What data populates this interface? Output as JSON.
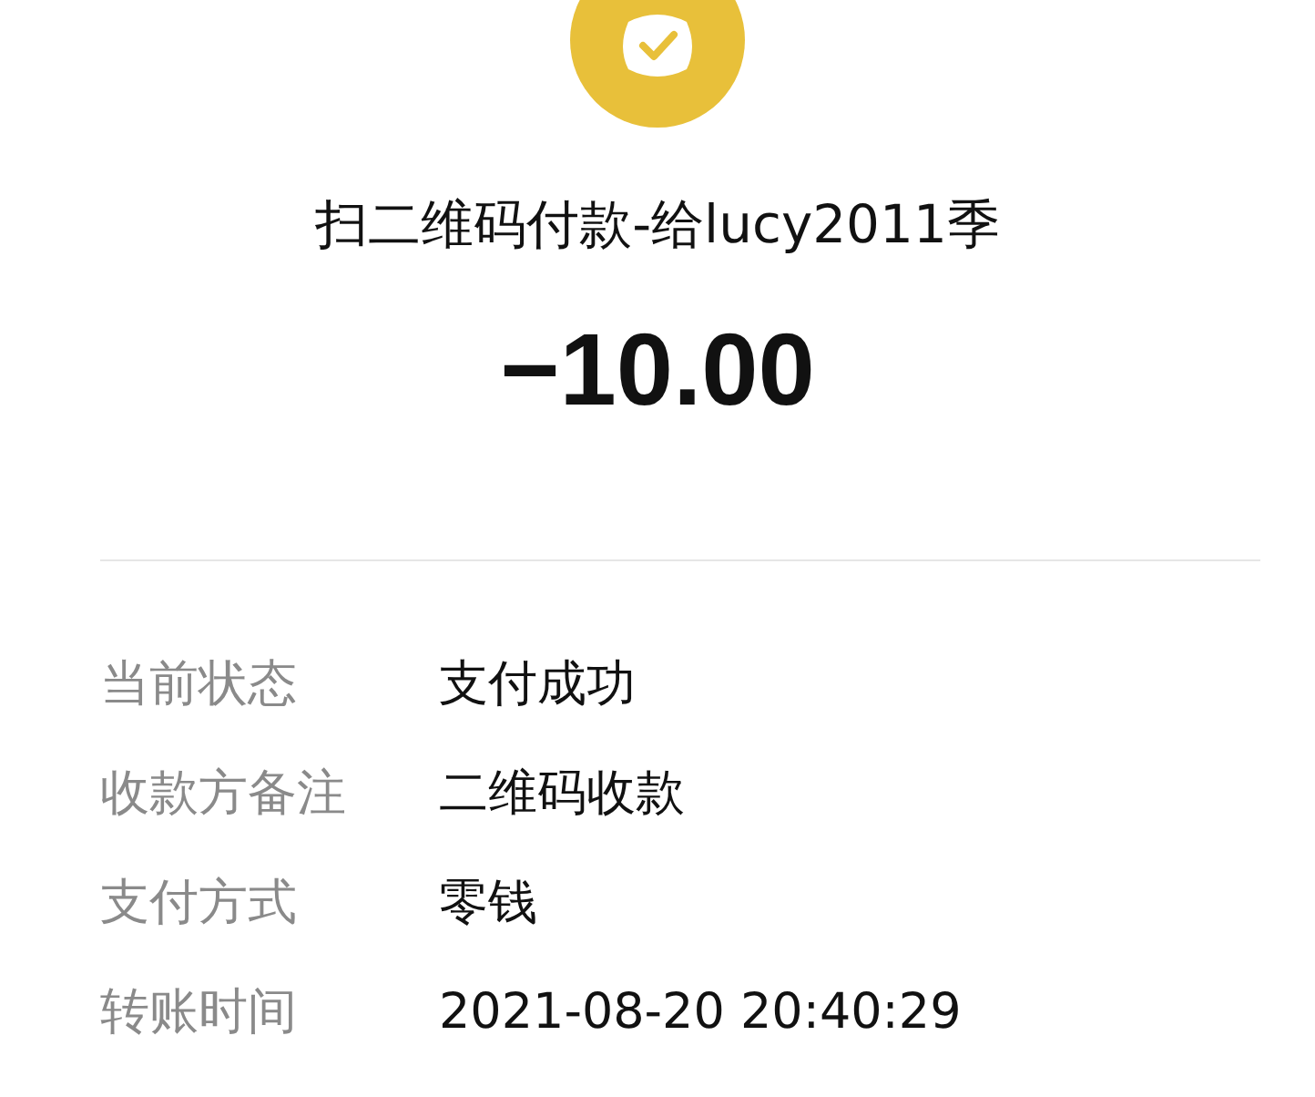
{
  "title": "扫二维码付款-给lucy2011季",
  "amount": "−10.00",
  "details": [
    {
      "label": "当前状态",
      "value": "支付成功"
    },
    {
      "label": "收款方备注",
      "value": "二维码收款"
    },
    {
      "label": "支付方式",
      "value": "零钱"
    },
    {
      "label": "转账时间",
      "value": "2021-08-20 20:40:29"
    }
  ]
}
